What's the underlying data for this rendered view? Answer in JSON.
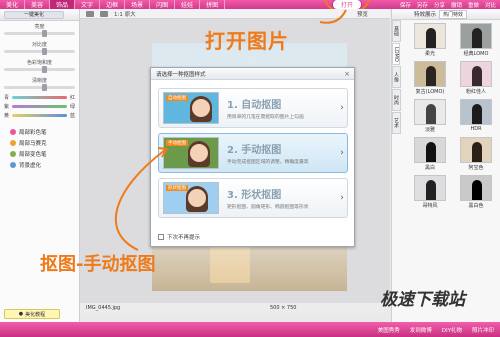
{
  "topbar": {
    "tabs": [
      "美化",
      "美容",
      "饰品",
      "文字",
      "边框",
      "场景",
      "闪图",
      "娃娃",
      "拼图"
    ],
    "open_label": "打开",
    "right_items": [
      "保存",
      "另存",
      "分享",
      "撤销",
      "重做",
      "对比"
    ]
  },
  "left": {
    "title": "一键美化",
    "sliders": [
      "亮度",
      "对比度",
      "色彩饱和度",
      "清晰度"
    ],
    "color_sliders": [
      {
        "left": "青",
        "right": "红",
        "color": "#e86a6a"
      },
      {
        "left": "紫",
        "right": "绿",
        "color": "#6cc46c"
      },
      {
        "left": "黄",
        "right": "蓝",
        "color": "#5b8fe0"
      }
    ],
    "effects": [
      "局部彩色笔",
      "局部马赛克",
      "局部变色笔",
      "背景虚化"
    ],
    "tutorial": "美化教程"
  },
  "toolbar": {
    "zoom": "1:1 原大",
    "preview": "预览"
  },
  "dialog": {
    "title": "请选择一种抠图样式",
    "options": [
      {
        "title": "1. 自动抠图",
        "desc": "用简单的几笔在需抠取的图片上勾画",
        "tag": "自动抠图"
      },
      {
        "title": "2. 手动抠图",
        "desc": "手动完成抠图区域的调整，精确度最高",
        "tag": "手动抠图"
      },
      {
        "title": "3. 形状抠图",
        "desc": "矩形抠图、圆角矩形、椭圆抠图等形状",
        "tag": "形状抠图"
      }
    ],
    "footer": "下次不再提示"
  },
  "annotations": {
    "open": "打开图片",
    "manual": "抠图-手动抠图"
  },
  "status": {
    "filename": "IMG_0445.jpg",
    "dims": "500 × 750"
  },
  "right": {
    "header": "特效展示",
    "select": "热门特效",
    "tabs": [
      "基础",
      "LOMO",
      "人像",
      "时尚",
      "艺术"
    ],
    "thumbs": [
      "柔光",
      "经典LOMO",
      "复古(LOMO)",
      "粉红佳人",
      "淡雅",
      "HDR",
      "黑白",
      "阿宝色",
      "哥特风",
      "黑白色"
    ]
  },
  "watermark": "极速下载站",
  "bottombar": [
    "美图秀秀",
    "发到微博",
    "DIY礼物",
    "照片冲印"
  ]
}
